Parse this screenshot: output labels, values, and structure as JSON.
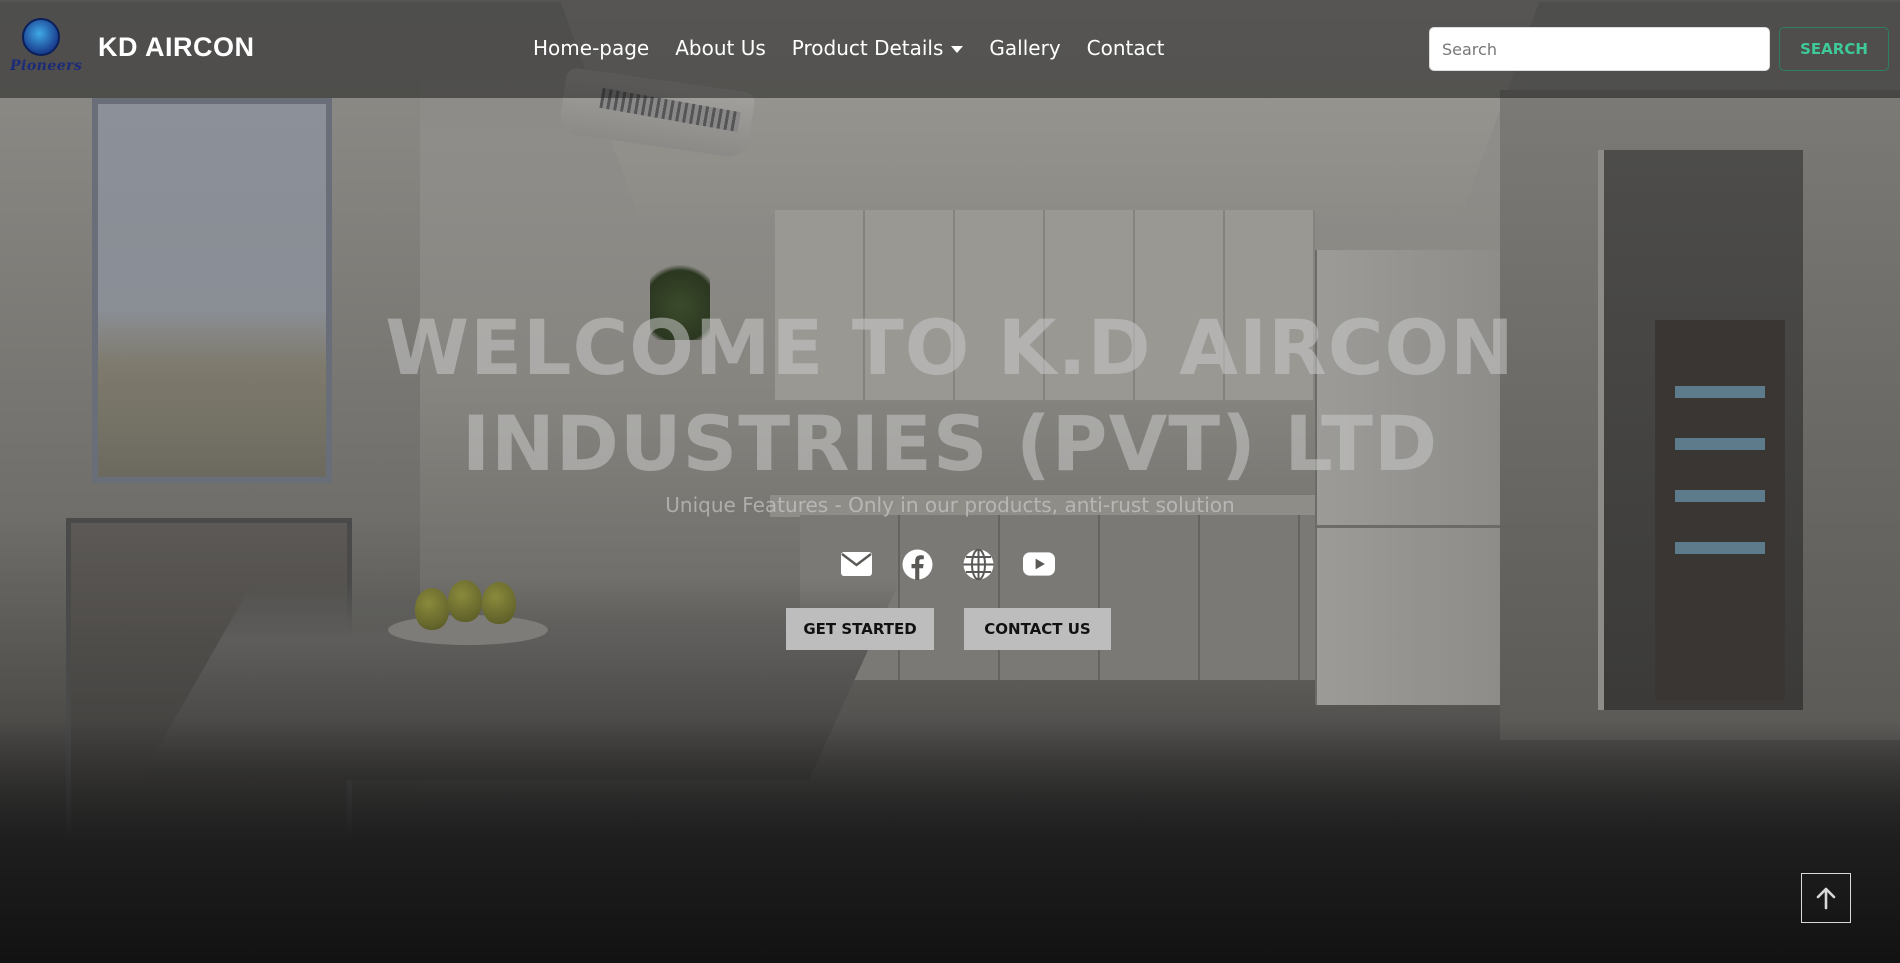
{
  "brand": {
    "logo_text": "Pioneers",
    "name": "KD AIRCON"
  },
  "nav": {
    "items": [
      {
        "label": "Home-page"
      },
      {
        "label": "About Us"
      },
      {
        "label": "Product Details",
        "has_dropdown": true
      },
      {
        "label": "Gallery"
      },
      {
        "label": "Contact"
      }
    ]
  },
  "search": {
    "placeholder": "Search",
    "value": "",
    "button_label": "SEARCH"
  },
  "hero": {
    "title_line1": "WELCOME TO K.D AIRCON",
    "title_line2": "INDUSTRIES (PVT) LTD",
    "subtitle": "Unique Features - Only in our products, anti-rust solution",
    "social_icons": [
      "envelope-icon",
      "facebook-icon",
      "globe-icon",
      "youtube-icon"
    ],
    "buttons": {
      "get_started": "GET STARTED",
      "contact_us": "CONTACT US"
    }
  },
  "colors": {
    "search_accent": "#3ec99a",
    "cta_bg": "#bdbdbd",
    "nav_text": "#ffffff"
  },
  "back_to_top": {
    "icon": "arrow-up-icon"
  }
}
